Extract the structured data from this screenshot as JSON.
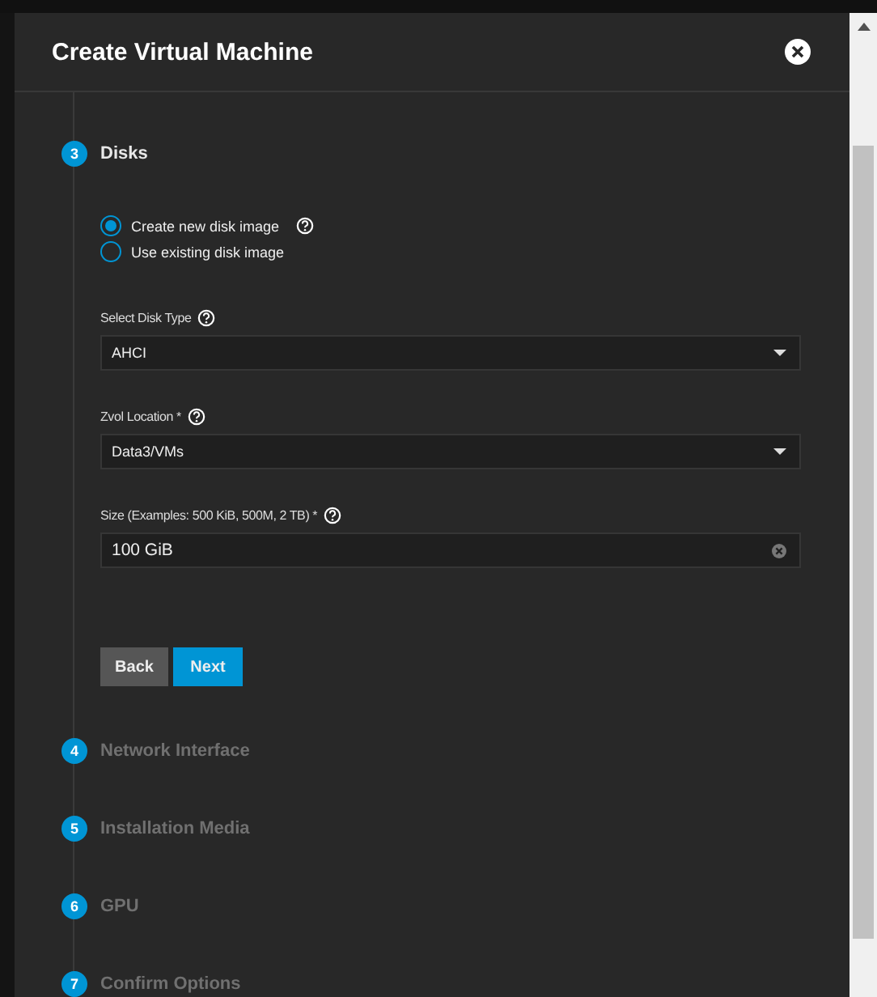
{
  "dialog": {
    "title": "Create Virtual Machine"
  },
  "steps": [
    {
      "number": "3",
      "label": "Disks",
      "active": true
    },
    {
      "number": "4",
      "label": "Network Interface",
      "active": false
    },
    {
      "number": "5",
      "label": "Installation Media",
      "active": false
    },
    {
      "number": "6",
      "label": "GPU",
      "active": false
    },
    {
      "number": "7",
      "label": "Confirm Options",
      "active": false
    }
  ],
  "disk_source": [
    {
      "label": "Create new disk image",
      "selected": true,
      "help": true
    },
    {
      "label": "Use existing disk image",
      "selected": false,
      "help": false
    }
  ],
  "fields": [
    {
      "kind": "select",
      "label": "Select Disk Type",
      "value": "AHCI"
    },
    {
      "kind": "select",
      "label": "Zvol Location *",
      "value": "Data3/VMs"
    },
    {
      "kind": "input",
      "label": "Size (Examples: 500 KiB, 500M, 2 TB) *",
      "value": "100 GiB"
    }
  ],
  "buttons": [
    {
      "label": "Back",
      "kind": "secondary"
    },
    {
      "label": "Next",
      "kind": "primary"
    }
  ]
}
